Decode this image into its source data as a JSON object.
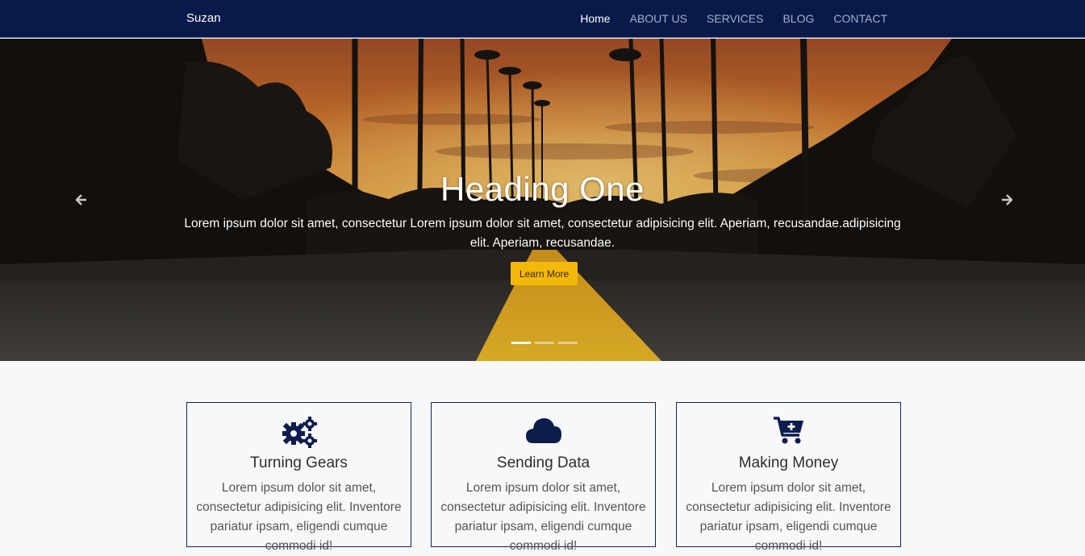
{
  "nav": {
    "brand": "Suzan",
    "links": [
      "Home",
      "ABOUT US",
      "SERVICES",
      "BLOG",
      "CONTACT"
    ],
    "active": "Home"
  },
  "hero": {
    "heading": "Heading One",
    "text": "Lorem ipsum dolor sit amet, consectetur Lorem ipsum dolor sit amet, consectetur adipisicing elit. Aperiam, recusandae.adipisicing elit. Aperiam, recusandae.",
    "button": "Learn More",
    "slide_count": 3,
    "active_slide": 1
  },
  "features": [
    {
      "icon": "gears-icon",
      "title": "Turning Gears",
      "text": "Lorem ipsum dolor sit amet, consectetur adipisicing elit. Inventore pariatur ipsam, eligendi cumque commodi id!"
    },
    {
      "icon": "cloud-icon",
      "title": "Sending Data",
      "text": "Lorem ipsum dolor sit amet, consectetur adipisicing elit. Inventore pariatur ipsam, eligendi cumque commodi id!"
    },
    {
      "icon": "cart-plus-icon",
      "title": "Making Money",
      "text": "Lorem ipsum dolor sit amet, consectetur adipisicing elit. Inventore pariatur ipsam, eligendi cumque commodi id!"
    }
  ],
  "colors": {
    "navbar": "#08194a",
    "accent": "#f4b80a",
    "icon": "#0d1c4d"
  }
}
